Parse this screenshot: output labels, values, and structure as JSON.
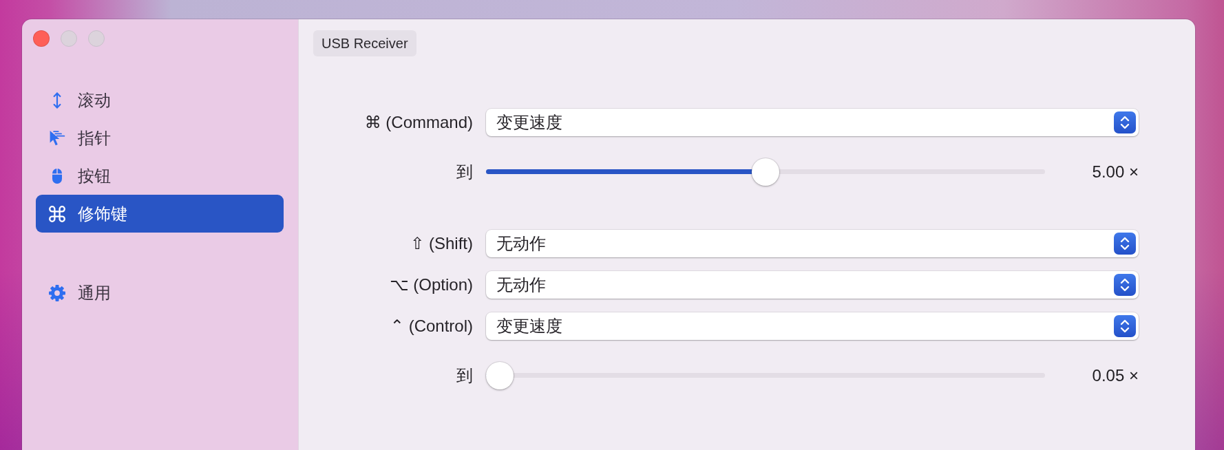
{
  "window": {
    "controls": [
      {
        "kind": "close",
        "disabled": false
      },
      {
        "kind": "minimize",
        "disabled": true
      },
      {
        "kind": "zoom",
        "disabled": true
      }
    ]
  },
  "sidebar": {
    "sections": [
      {
        "items": [
          {
            "kind": "scroll",
            "label": "滚动",
            "selected": false
          },
          {
            "kind": "pointer",
            "label": "指针",
            "selected": false
          },
          {
            "kind": "buttons",
            "label": "按钮",
            "selected": false
          },
          {
            "kind": "modifier",
            "label": "修饰键",
            "selected": true
          }
        ]
      },
      {
        "items": [
          {
            "kind": "general",
            "label": "通用",
            "selected": false
          }
        ]
      }
    ]
  },
  "device_button": {
    "label": "USB Receiver"
  },
  "settings": {
    "groups": [
      {
        "rows": [
          {
            "kind": "popup",
            "label": "⌘ (Command)",
            "value": "变更速度"
          },
          {
            "kind": "slider",
            "label": "到",
            "level": 0.5,
            "reading": "5.00 ×"
          }
        ]
      },
      {
        "rows": [
          {
            "kind": "popup",
            "label": "⇧ (Shift)",
            "value": "无动作"
          },
          {
            "kind": "popup",
            "label": "⌥ (Option)",
            "value": "无动作"
          },
          {
            "kind": "popup",
            "label": "⌃ (Control)",
            "value": "变更速度"
          },
          {
            "kind": "slider",
            "label": "到",
            "level": 0,
            "reading": "0.05 ×"
          }
        ]
      }
    ]
  }
}
